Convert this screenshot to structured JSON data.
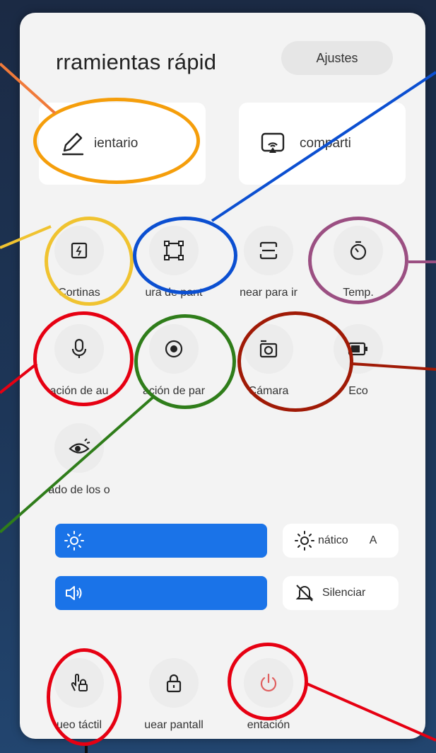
{
  "header": {
    "title": "rramientas rápid",
    "settings_label": "Ajustes"
  },
  "cards": {
    "comment_label": "ientario",
    "share_label": "comparti"
  },
  "tiles_row1": [
    "Cortinas",
    "ura de pant",
    "near para ir",
    "Temp."
  ],
  "tiles_row2": [
    "ación de au",
    "ación de par",
    "Cámara",
    "Eco"
  ],
  "tiles_row3": [
    "ado de los o"
  ],
  "brightness": {
    "level": 1.0,
    "auto_label": "nático",
    "auto_value": "A"
  },
  "volume": {
    "level": 1.0,
    "mute_label": "Silenciar"
  },
  "bottom": [
    "ueo táctil",
    "uear pantall",
    "entación"
  ],
  "colors": {
    "accent": "#1a73e8",
    "annot_orange": "#f59e0b",
    "annot_yellow": "#f0c330",
    "annot_blue": "#0b4fd1",
    "annot_purple": "#9b4f82",
    "annot_red": "#e60012",
    "annot_green": "#2f7d1a",
    "annot_darkred": "#a01a06",
    "power_red": "#e06060"
  }
}
